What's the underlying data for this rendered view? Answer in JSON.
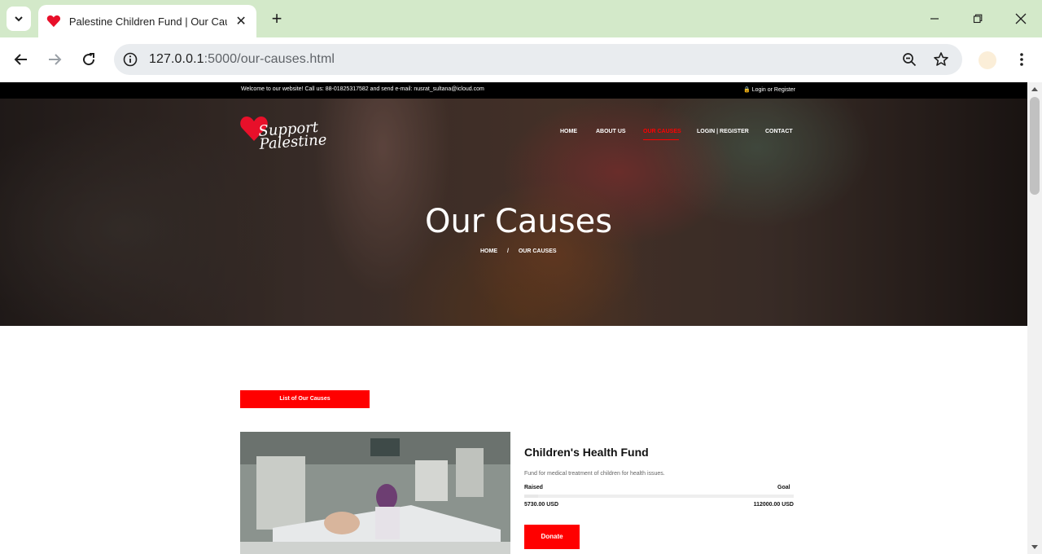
{
  "browser": {
    "tab_title": "Palestine Children Fund | Our Causes",
    "url_host": "127.0.0.1",
    "url_path": ":5000/our-causes.html",
    "tabstrip_color": "#d3e9c9"
  },
  "site": {
    "topbar": {
      "welcome": "Welcome to our website! Call us: 88-01825317582 and send e-mail: nusrat_sultana@icloud.com",
      "login": "Login or Register"
    },
    "logo_text_1": "Support",
    "logo_text_2": "Palestine",
    "nav": [
      {
        "label": "HOME"
      },
      {
        "label": "ABOUT US"
      },
      {
        "label": "OUR CAUSES",
        "active": true
      },
      {
        "label": "LOGIN | REGISTER"
      },
      {
        "label": "CONTACT"
      }
    ],
    "hero_title": "Our Causes",
    "breadcrumb": {
      "home": "HOME",
      "sep": "/",
      "current": "OUR CAUSES"
    },
    "list_button": "List of Our Causes",
    "cause": {
      "title": "Children's Health Fund",
      "description": "Fund for medical treatment of children for health issues.",
      "raised_label": "Raised",
      "goal_label": "Goal",
      "raised_value": "5730.00 USD",
      "goal_value": "112000.00 USD",
      "progress_fraction": 0.051,
      "donate_label": "Donate"
    },
    "accent_color": "#ff0000"
  }
}
